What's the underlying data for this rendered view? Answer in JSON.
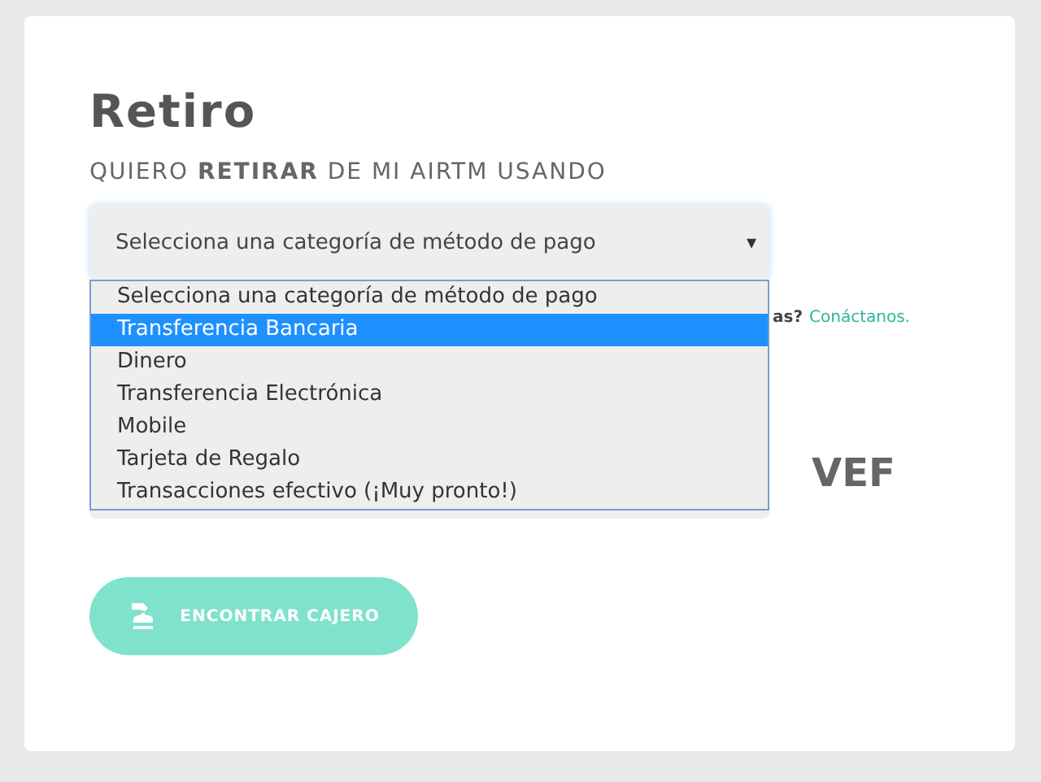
{
  "title": "Retiro",
  "subtitle": "QUIERO **RETIRAR** DE MI AIRTM USANDO",
  "select": {
    "value": "Selecciona una categoría de método de pago",
    "arrow": "▾",
    "expanded": true
  },
  "options": [
    {
      "label": "Selecciona una categoría de método de pago",
      "selected": false
    },
    {
      "label": "Transferencia Bancaria",
      "selected": true
    },
    {
      "label": "Dinero",
      "selected": false
    },
    {
      "label": "Transferencia Electrónica",
      "selected": false
    },
    {
      "label": "Mobile",
      "selected": false
    },
    {
      "label": "Tarjeta de Regalo",
      "selected": false
    },
    {
      "label": "Transacciones efectivo (¡Muy pronto!)",
      "selected": false
    }
  ],
  "help": {
    "text": "as?",
    "link": "Conáctanos."
  },
  "currency": "VEF",
  "button": "ENCONTRAR CAJERO"
}
